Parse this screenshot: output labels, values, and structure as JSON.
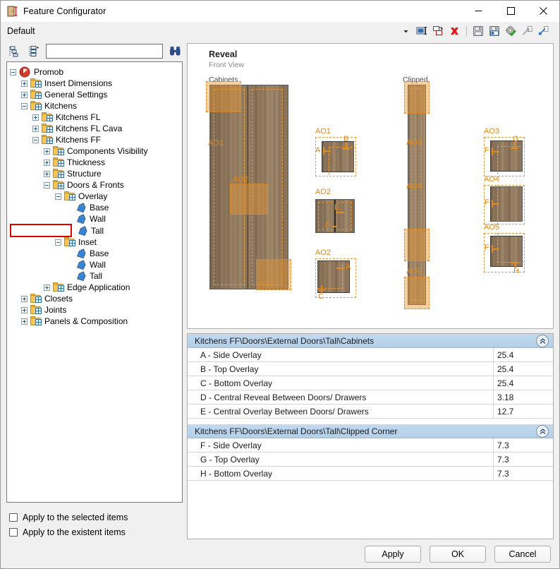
{
  "window": {
    "title": "Feature Configurator",
    "icon": "door-dimension-icon",
    "controls": {
      "minimize": "–",
      "maximize": "☐",
      "close": "✕"
    }
  },
  "presetbar": {
    "label": "Default",
    "dropdown_icon": "chevron-down-icon",
    "tools": [
      {
        "name": "rename-feature-icon",
        "glyph": "rename"
      },
      {
        "name": "duplicate-feature-icon",
        "glyph": "duplicate"
      },
      {
        "name": "delete-feature-icon",
        "glyph": "delete"
      },
      {
        "name": "save-icon",
        "glyph": "save"
      },
      {
        "name": "save-as-icon",
        "glyph": "save-as"
      },
      {
        "name": "settings-apply-icon",
        "glyph": "gear-check"
      },
      {
        "name": "export-icon",
        "glyph": "export"
      },
      {
        "name": "import-icon",
        "glyph": "import"
      }
    ]
  },
  "left_panel": {
    "toolbar": [
      {
        "name": "collapse-all-icon"
      },
      {
        "name": "expand-all-icon"
      },
      {
        "name": "find-binoculars-icon"
      }
    ],
    "search": {
      "value": "",
      "placeholder": ""
    },
    "tree": [
      {
        "label": "Promob",
        "depth": 0,
        "state": "expanded",
        "icon": "promob-logo-icon"
      },
      {
        "label": "Insert Dimensions",
        "depth": 1,
        "state": "collapsed",
        "icon": "folder-icon"
      },
      {
        "label": "General Settings",
        "depth": 1,
        "state": "collapsed",
        "icon": "folder-icon"
      },
      {
        "label": "Kitchens",
        "depth": 1,
        "state": "expanded",
        "icon": "folder-icon"
      },
      {
        "label": "Kitchens FL",
        "depth": 2,
        "state": "collapsed",
        "icon": "folder-icon"
      },
      {
        "label": "Kitchens FL Cava",
        "depth": 2,
        "state": "collapsed",
        "icon": "folder-icon"
      },
      {
        "label": "Kitchens FF",
        "depth": 2,
        "state": "expanded",
        "icon": "folder-icon"
      },
      {
        "label": "Components Visibility",
        "depth": 3,
        "state": "collapsed",
        "icon": "folder-icon"
      },
      {
        "label": "Thickness",
        "depth": 3,
        "state": "collapsed",
        "icon": "folder-icon"
      },
      {
        "label": "Structure",
        "depth": 3,
        "state": "collapsed",
        "icon": "folder-icon"
      },
      {
        "label": "Doors & Fronts",
        "depth": 3,
        "state": "expanded",
        "icon": "folder-icon"
      },
      {
        "label": "Overlay",
        "depth": 4,
        "state": "expanded",
        "icon": "folder-icon"
      },
      {
        "label": "Base",
        "depth": 5,
        "state": "leaf",
        "icon": "tag-icon"
      },
      {
        "label": "Wall",
        "depth": 5,
        "state": "leaf",
        "icon": "tag-icon"
      },
      {
        "label": "Tall",
        "depth": 5,
        "state": "leaf",
        "icon": "tag-icon",
        "selected": true
      },
      {
        "label": "Inset",
        "depth": 4,
        "state": "expanded",
        "icon": "folder-icon"
      },
      {
        "label": "Base",
        "depth": 5,
        "state": "leaf",
        "icon": "tag-icon"
      },
      {
        "label": "Wall",
        "depth": 5,
        "state": "leaf",
        "icon": "tag-icon"
      },
      {
        "label": "Tall",
        "depth": 5,
        "state": "leaf",
        "icon": "tag-icon"
      },
      {
        "label": "Edge Application",
        "depth": 3,
        "state": "collapsed",
        "icon": "folder-icon"
      },
      {
        "label": "Closets",
        "depth": 1,
        "state": "collapsed",
        "icon": "folder-icon"
      },
      {
        "label": "Joints",
        "depth": 1,
        "state": "collapsed",
        "icon": "folder-icon"
      },
      {
        "label": "Panels & Composition",
        "depth": 1,
        "state": "collapsed",
        "icon": "folder-icon"
      }
    ],
    "checkboxes": [
      {
        "label": "Apply to the selected items",
        "checked": false
      },
      {
        "label": "Apply to the existent items",
        "checked": false
      }
    ]
  },
  "preview": {
    "title": "Reveal",
    "subtitle": "Front View",
    "caption_cabinets": "Cabinets",
    "caption_clipped": "Clipped",
    "tags": {
      "ao1": "AO1",
      "ao2": "AO2",
      "ao3": "AO3",
      "ao4": "AO4",
      "ao5": "AO5"
    },
    "dim_letters": {
      "a": "A",
      "b": "B",
      "c": "C",
      "d": "D",
      "e": "E",
      "f": "F",
      "g": "G",
      "h": "H"
    },
    "accent_color": "#e08a20"
  },
  "grid": {
    "groups": [
      {
        "title": "Kitchens FF\\Doors\\External Doors\\Tall\\Cabinets",
        "collapse_icon": "chevron-double-up-icon",
        "rows": [
          {
            "name": "A - Side Overlay",
            "value": "25.4"
          },
          {
            "name": "B - Top Overlay",
            "value": "25.4"
          },
          {
            "name": "C - Bottom Overlay",
            "value": "25.4"
          },
          {
            "name": "D - Central Reveal Between Doors/ Drawers",
            "value": "3.18"
          },
          {
            "name": "E - Central Overlay Between Doors/ Drawers",
            "value": "12.7"
          }
        ]
      },
      {
        "title": "Kitchens FF\\Doors\\External Doors\\Tall\\Clipped Corner",
        "collapse_icon": "chevron-double-up-icon",
        "rows": [
          {
            "name": "F - Side Overlay",
            "value": "7.3"
          },
          {
            "name": "G - Top Overlay",
            "value": "7.3"
          },
          {
            "name": "H - Bottom Overlay",
            "value": "7.3"
          }
        ]
      }
    ]
  },
  "footer": {
    "apply": "Apply",
    "ok": "OK",
    "cancel": "Cancel"
  }
}
